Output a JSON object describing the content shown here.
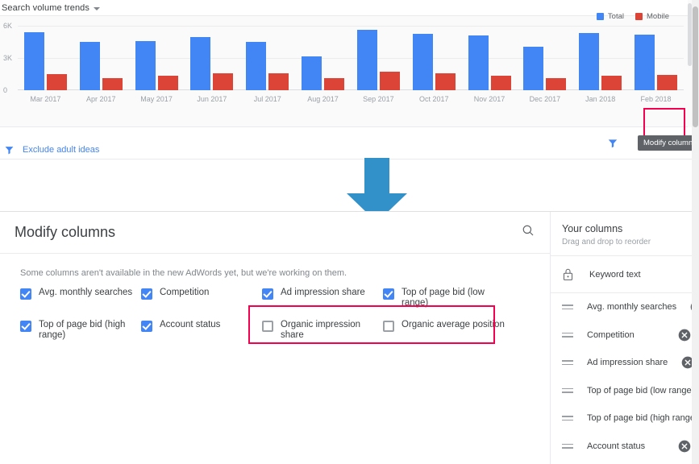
{
  "chart_panel": {
    "title": "Search volume trends",
    "caret_icon": "chevron-down-icon",
    "legend": [
      {
        "label": "Total",
        "color": "#4285f4"
      },
      {
        "label": "Mobile",
        "color": "#db4437"
      }
    ]
  },
  "chart_data": {
    "type": "bar",
    "title": "Search volume trends",
    "xlabel": "",
    "ylabel": "",
    "ylim": [
      0,
      6000
    ],
    "yticks": [
      "0",
      "3K",
      "6K"
    ],
    "ytick_values": [
      0,
      3000,
      6000
    ],
    "grid": true,
    "legend_position": "top-right",
    "categories": [
      "Mar 2017",
      "Apr 2017",
      "May 2017",
      "Jun 2017",
      "Jul 2017",
      "Aug 2017",
      "Sep 2017",
      "Oct 2017",
      "Nov 2017",
      "Dec 2017",
      "Jan 2018",
      "Feb 2018"
    ],
    "series": [
      {
        "name": "Total",
        "color": "#4285f4",
        "values": [
          5400,
          4500,
          4600,
          4950,
          4500,
          3150,
          5650,
          5250,
          5100,
          4050,
          5350,
          5200
        ]
      },
      {
        "name": "Mobile",
        "color": "#db4437",
        "values": [
          1500,
          1100,
          1350,
          1550,
          1600,
          1100,
          1700,
          1600,
          1350,
          1100,
          1350,
          1450
        ]
      }
    ]
  },
  "toolbar": {
    "filter_icon": "filter-icon",
    "columns_icon": "modify-columns-icon",
    "download_icon": "download-icon",
    "tooltip": "Modify columns",
    "highlight_color": "#f4004e"
  },
  "filter_row": {
    "icon": "filter-icon",
    "label": "Exclude adult ideas"
  },
  "annotation": {
    "arrow_icon": "down-arrow-annotation",
    "color": "#3291c8"
  },
  "dialog": {
    "title": "Modify columns",
    "search_icon": "search-icon",
    "note": "Some columns aren't available in the new AdWords yet, but we're working on them.",
    "checkbox_rows": [
      [
        {
          "label": "Avg. monthly searches",
          "checked": true
        },
        {
          "label": "Competition",
          "checked": true
        },
        {
          "label": "Ad impression share",
          "checked": true
        },
        {
          "label": "Top of page bid (low range)",
          "checked": true
        }
      ],
      [
        {
          "label": "Top of page bid (high range)",
          "checked": true
        },
        {
          "label": "Account status",
          "checked": true
        },
        {
          "label": "Organic impression share",
          "checked": false
        },
        {
          "label": "Organic average position",
          "checked": false
        }
      ]
    ],
    "highlight_color": "#f4004e"
  },
  "your_columns": {
    "title": "Your columns",
    "subtitle": "Drag and drop to reorder",
    "locked_item": {
      "label": "Keyword text",
      "icon": "lock-icon"
    },
    "items": [
      {
        "label": "Avg. monthly searches",
        "handle_icon": "drag-handle-icon",
        "remove_icon": "remove-circle-icon"
      },
      {
        "label": "Competition",
        "handle_icon": "drag-handle-icon",
        "remove_icon": "remove-circle-icon"
      },
      {
        "label": "Ad impression share",
        "handle_icon": "drag-handle-icon",
        "remove_icon": "remove-circle-icon"
      },
      {
        "label": "Top of page bid (low range)",
        "handle_icon": "drag-handle-icon",
        "remove_icon": "remove-circle-icon"
      },
      {
        "label": "Top of page bid (high range)",
        "handle_icon": "drag-handle-icon",
        "remove_icon": "remove-circle-icon"
      },
      {
        "label": "Account status",
        "handle_icon": "drag-handle-icon",
        "remove_icon": "remove-circle-icon"
      }
    ]
  }
}
